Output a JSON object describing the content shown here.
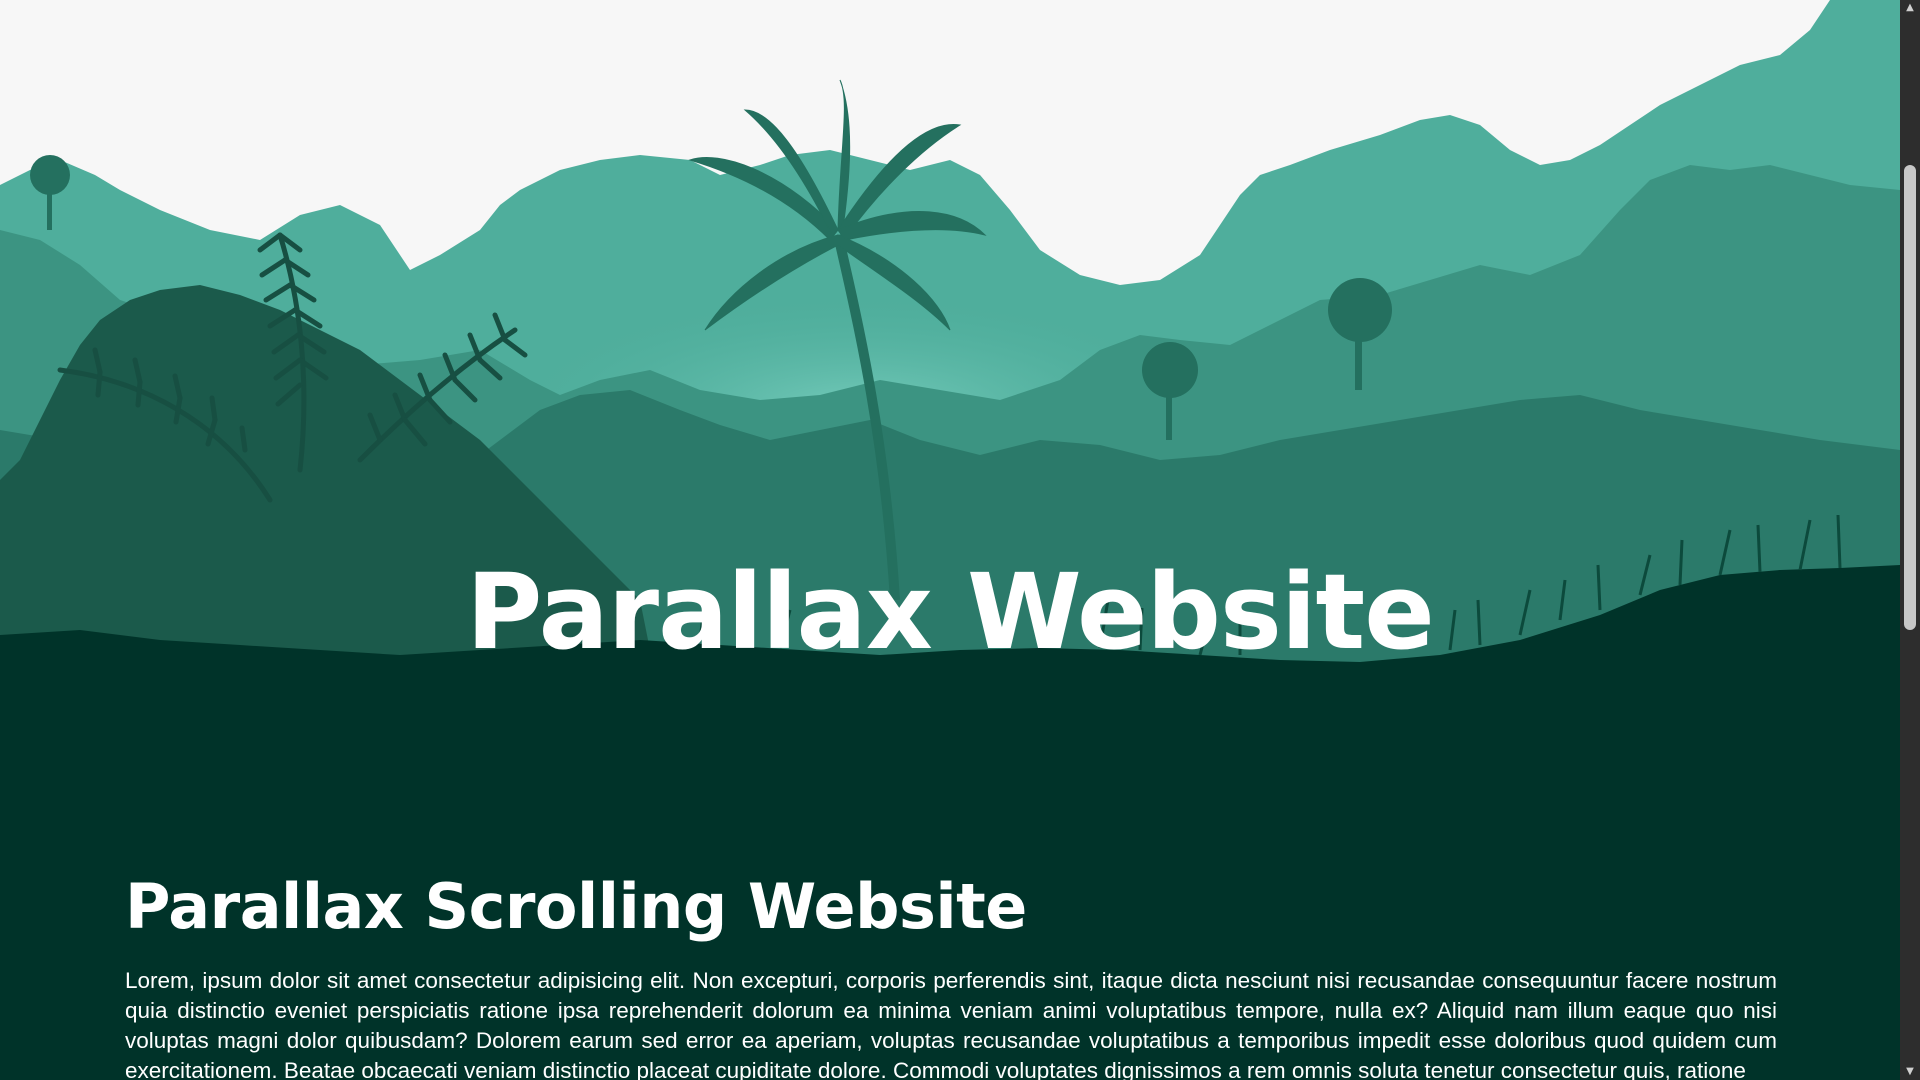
{
  "hero": {
    "title": "Parallax Website"
  },
  "section": {
    "heading": "Parallax Scrolling Website",
    "body": "Lorem, ipsum dolor sit amet consectetur adipisicing elit. Non excepturi, corporis perferendis sint, itaque dicta nesciunt nisi recusandae consequuntur facere nostrum quia distinctio eveniet perspiciatis ratione ipsa reprehenderit dolorum ea minima veniam animi voluptatibus tempore, nulla ex? Aliquid nam illum eaque quo nisi voluptas magni dolor quibusdam? Dolorem earum sed error ea aperiam, voluptas recusandae voluptatibus a temporibus impedit esse doloribus quod quidem cum exercitationem. Beatae obcaecati veniam distinctio placeat cupiditate dolore. Commodi voluptates dignissimos a rem omnis soluta tenetur consectetur quis, ratione"
  },
  "scrollbar": {
    "up_icon": "scroll-up-arrow-icon",
    "down_icon": "scroll-down-arrow-icon"
  },
  "colors": {
    "sky": "#f7f7f7",
    "far_mountains": "#4fae9c",
    "mid_hills": "#3c9482",
    "near_hills": "#2b7a6a",
    "foliage_dark": "#1b5a4b",
    "ground": "#003329",
    "text": "#ffffff",
    "scrollbar_track": "#2d2d2d",
    "scrollbar_thumb": "#c8c8c8"
  }
}
